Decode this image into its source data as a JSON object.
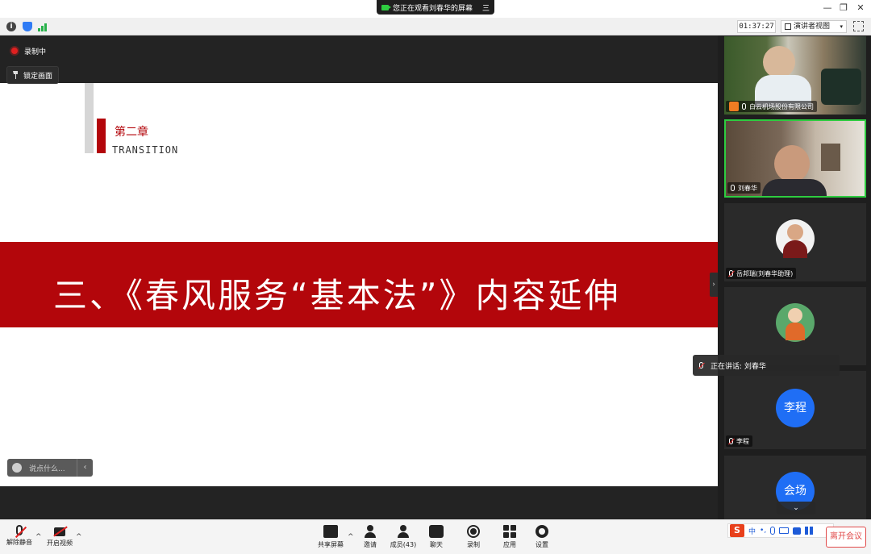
{
  "titlebar": {
    "share_banner": "您正在观看刘春华的屏幕",
    "share_menu": "三",
    "min": "—",
    "restore": "❐",
    "close": "✕"
  },
  "toolbar": {
    "timer": "01:37:27",
    "view_mode": "演讲者视图",
    "view_caret": "▾"
  },
  "share": {
    "recording_label": "录制中",
    "lock_label": "锁定画面",
    "chat_placeholder": "说点什么...",
    "chat_collapse": "‹",
    "side_collapse": "›"
  },
  "slide": {
    "chapter": "第二章",
    "subtitle": "TRANSITION",
    "title": "三、《春风服务“基本法”》内容延伸"
  },
  "participants": [
    {
      "name": "白云机场股份有限公司",
      "type": "video",
      "muted": false
    },
    {
      "name": "刘春华",
      "type": "video",
      "muted": false,
      "active": true
    },
    {
      "name": "岳邦瑞(刘春华助理)",
      "type": "avatar",
      "muted": true
    },
    {
      "name": "",
      "type": "avatar",
      "muted": true
    },
    {
      "name": "李程",
      "avatar_text": "李程",
      "type": "initials",
      "muted": true
    },
    {
      "name": "",
      "avatar_text": "会场",
      "type": "initials",
      "muted": true
    }
  ],
  "speaking": {
    "text": "正在讲话: 刘春华"
  },
  "scroll_down": "⌄",
  "bottom": {
    "unmute": "解除静音",
    "start_video": "开启视频",
    "share_screen": "共享屏幕",
    "invite": "邀请",
    "members": "成员(43)",
    "chat": "聊天",
    "record": "录制",
    "apps": "应用",
    "settings": "设置",
    "caret": "^",
    "leave": "离开会议"
  },
  "ime": {
    "logo": "S",
    "lang": "中",
    "punct": "•,",
    "icons": [
      "mic-icon",
      "keyboard-icon",
      "shirt-icon",
      "grid-icon"
    ]
  },
  "colors": {
    "slide_red": "#b3060b",
    "active_border": "#2ecc40",
    "avatar_blue": "#1f6ef5",
    "leave_red": "#e14b4b"
  }
}
